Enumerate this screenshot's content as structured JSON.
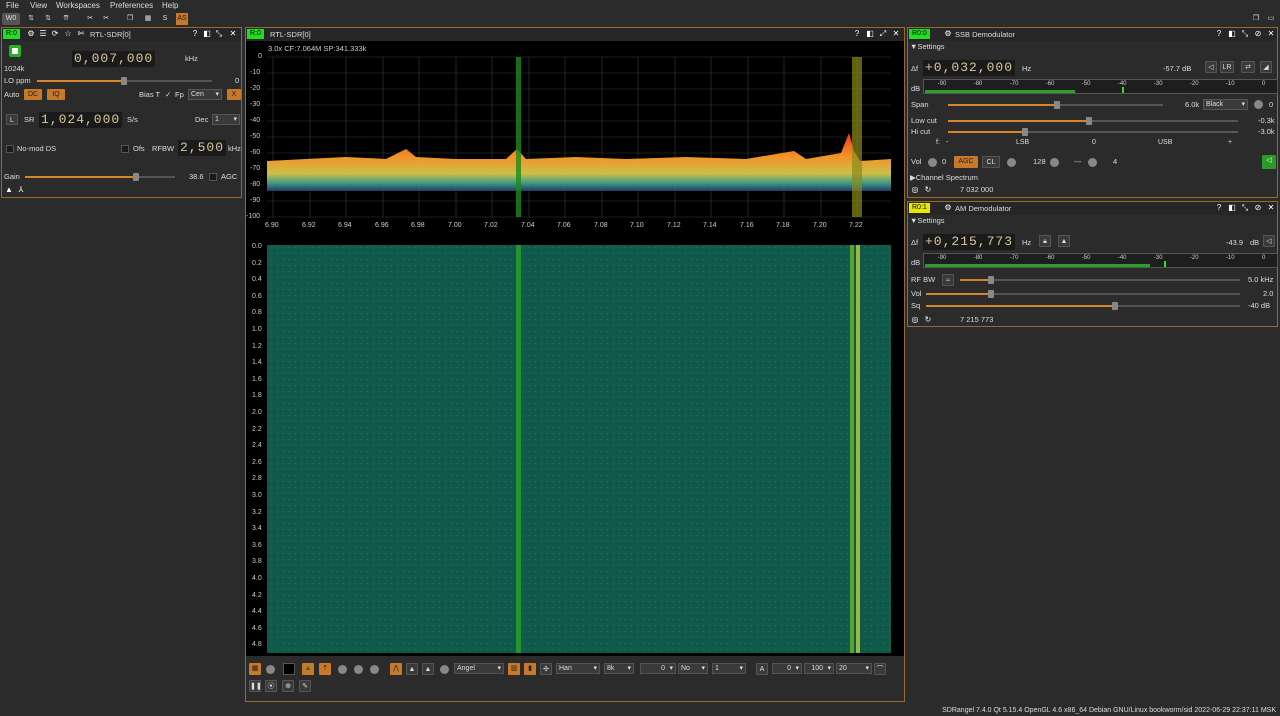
{
  "menu": [
    "File",
    "View",
    "Workspaces",
    "Preferences",
    "Help"
  ],
  "toolbar": {
    "w0": "W0",
    "s": "S",
    "as": "AS"
  },
  "device_panel": {
    "tag": "R:0",
    "title": "RTL-SDR[0]",
    "sample_rate_label": "1024k",
    "freq": "0,007,000",
    "freq_unit": "kHz",
    "lo_ppm_label": "LO ppm",
    "lo_ppm_value": "0",
    "auto_label": "Auto",
    "dc": "DC",
    "iq": "IQ",
    "bias_t": "Bias T",
    "fp": "Fp",
    "fp_combo": "Cen",
    "x": "X",
    "l": "L",
    "sr": "SR",
    "sr_value": "1,024,000",
    "sr_unit": "S/s",
    "dec": "Dec",
    "dec_value": "1",
    "nomod": "No-mod DS",
    "ofs": "Ofs",
    "rfbw": "RFBW",
    "rfbw_value": "2,500",
    "rfbw_unit": "kHz",
    "gain": "Gain",
    "gain_value": "38.6",
    "agc": "AGC"
  },
  "spectrum_panel": {
    "tag": "R:0",
    "title": "RTL-SDR[0]",
    "info": "3.0x CF:7.064M SP:341.333k",
    "y_ticks": [
      "0",
      "-10",
      "-20",
      "-30",
      "-40",
      "-50",
      "-60",
      "-70",
      "-80",
      "-90",
      "-100"
    ],
    "x_ticks": [
      "6.90",
      "6.92",
      "6.94",
      "6.96",
      "6.98",
      "7.00",
      "7.02",
      "7.04",
      "7.06",
      "7.08",
      "7.10",
      "7.12",
      "7.14",
      "7.16",
      "7.18",
      "7.20",
      "7.22"
    ],
    "wf_ticks": [
      "0.0",
      "0.2",
      "0.4",
      "0.6",
      "0.8",
      "1.0",
      "1.2",
      "1.4",
      "1.6",
      "1.8",
      "2.0",
      "2.2",
      "2.4",
      "2.6",
      "2.8",
      "3.0",
      "3.2",
      "3.4",
      "3.6",
      "3.8",
      "4.0",
      "4.2",
      "4.4",
      "4.6",
      "4.8"
    ],
    "palette": "Angel",
    "window": "Han",
    "fft": "8k",
    "avg_val": "0",
    "avg_mode": "No",
    "avg_n": "1",
    "a": "A",
    "ref": "0",
    "range": "100",
    "rate": "20"
  },
  "ssb_panel": {
    "tag": "R0:0",
    "title": "SSB Demodulator",
    "settings": "Settings",
    "df": "Δf",
    "df_value": "+0,032,000",
    "df_unit": "Hz",
    "level": "-57.7 dB",
    "lr": "LR",
    "db": "dB",
    "meter_ticks": [
      "-90",
      "-80",
      "-70",
      "-60",
      "-50",
      "-40",
      "-30",
      "-20",
      "-10",
      "0"
    ],
    "span": "Span",
    "span_value": "6.0k",
    "span_combo": "Black",
    "span_extra": "0",
    "lowcut": "Low cut",
    "lowcut_value": "-0.3k",
    "hicut": "Hi cut",
    "hicut_value": "-3.0k",
    "scale": [
      "f:",
      "-",
      "LSB",
      "0",
      "USB",
      "+"
    ],
    "vol": "Vol",
    "vol_value": "0",
    "agc": "AGC",
    "cl": "CL",
    "agc_val": "128",
    "dash": "---",
    "n": "4",
    "channel_spectrum": "Channel Spectrum",
    "freq": "7 032 000"
  },
  "am_panel": {
    "tag": "R0:1",
    "title": "AM Demodulator",
    "settings": "Settings",
    "df": "Δf",
    "df_value": "+0,215,773",
    "df_unit": "Hz",
    "level": "-43.9",
    "level_unit": "dB",
    "db": "dB",
    "meter_ticks": [
      "-90",
      "-80",
      "-70",
      "-60",
      "-50",
      "-40",
      "-30",
      "-20",
      "-10",
      "0"
    ],
    "rfbw": "RF BW",
    "rfbw_value": "5.0 kHz",
    "vol": "Vol",
    "vol_value": "2.0",
    "sq": "Sq",
    "sq_value": "-40 dB",
    "freq": "7 215 773"
  },
  "status": "SDRangel 7.4.0 Qt 5.15.4 OpenGL 4.6 x86_64 Debian GNU/Linux bookworm/sid  2022-06-29 22:37:11 MSK",
  "colors": {
    "accent": "#d6862a",
    "green_tag": "#22dd22",
    "yellow_tag": "#e8e800"
  }
}
